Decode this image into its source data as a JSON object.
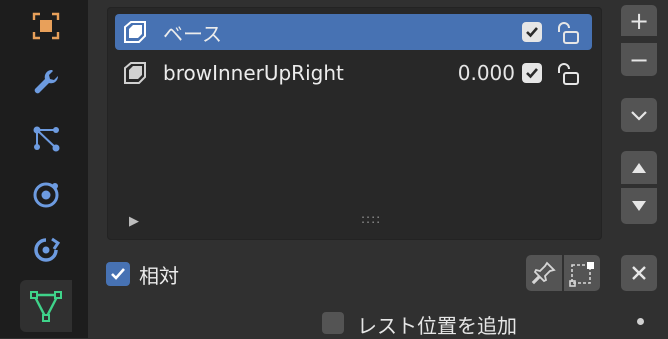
{
  "tabs": [
    {
      "icon": "object-data-icon"
    },
    {
      "icon": "wrench-icon"
    },
    {
      "icon": "particles-icon"
    },
    {
      "icon": "physics-icon"
    },
    {
      "icon": "constraints-icon"
    },
    {
      "icon": "mesh-data-icon",
      "active": true
    }
  ],
  "shape_keys": {
    "rows": [
      {
        "name": "ベース",
        "value": "",
        "selected": true
      },
      {
        "name": "browInnerUpRight",
        "value": "0.000",
        "selected": false
      }
    ]
  },
  "side_buttons": {
    "add": "+",
    "remove": "−"
  },
  "relative": {
    "label": "相対",
    "checked": true
  },
  "add_rest_position": {
    "label": "レスト位置を追加",
    "checked": false
  },
  "colors": {
    "accent": "#4772b3",
    "panel": "#303030",
    "list": "#282828",
    "button": "#545454"
  }
}
